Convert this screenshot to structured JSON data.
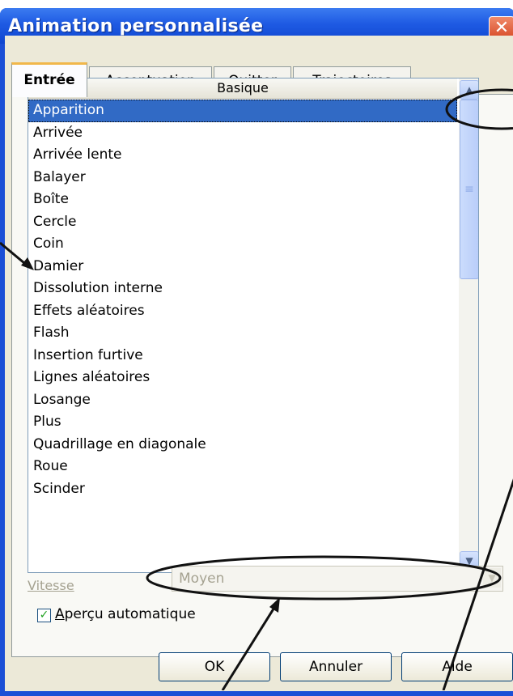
{
  "window": {
    "title": "Animation personnalisée",
    "close_glyph": "✕"
  },
  "tabs": [
    {
      "label": "Entrée",
      "active": true
    },
    {
      "label": "Accentuation",
      "active": false
    },
    {
      "label": "Quitter",
      "active": false
    },
    {
      "label": "Trajectoires",
      "active": false
    }
  ],
  "effects_list": {
    "header": "Basique",
    "items": [
      "Apparition",
      "Arrivée",
      "Arrivée lente",
      "Balayer",
      "Boîte",
      "Cercle",
      "Coin",
      "Damier",
      "Dissolution interne",
      "Effets aléatoires",
      "Flash",
      "Insertion furtive",
      "Lignes aléatoires",
      "Losange",
      "Plus",
      "Quadrillage en diagonale",
      "Roue",
      "Scinder"
    ],
    "selected_index": 0
  },
  "speed": {
    "label": "Vitesse",
    "value": "Moyen"
  },
  "auto_preview": {
    "label_underlined": "A",
    "label_rest": "perçu automatique",
    "checked": true
  },
  "buttons": {
    "ok": "OK",
    "cancel": "Annuler",
    "help": "Aide"
  },
  "colors": {
    "title_bar": "#1e5ae3",
    "close_button": "#d4431f",
    "selection": "#316ac5",
    "dialog_face": "#ece9d8",
    "active_tab_highlight": "#f1b74a"
  },
  "icons": {
    "close": "close-icon",
    "scroll_up": "chevron-up-icon",
    "scroll_down": "chevron-down-icon",
    "dropdown": "chevron-down-icon",
    "checkmark": "checkmark-icon"
  }
}
